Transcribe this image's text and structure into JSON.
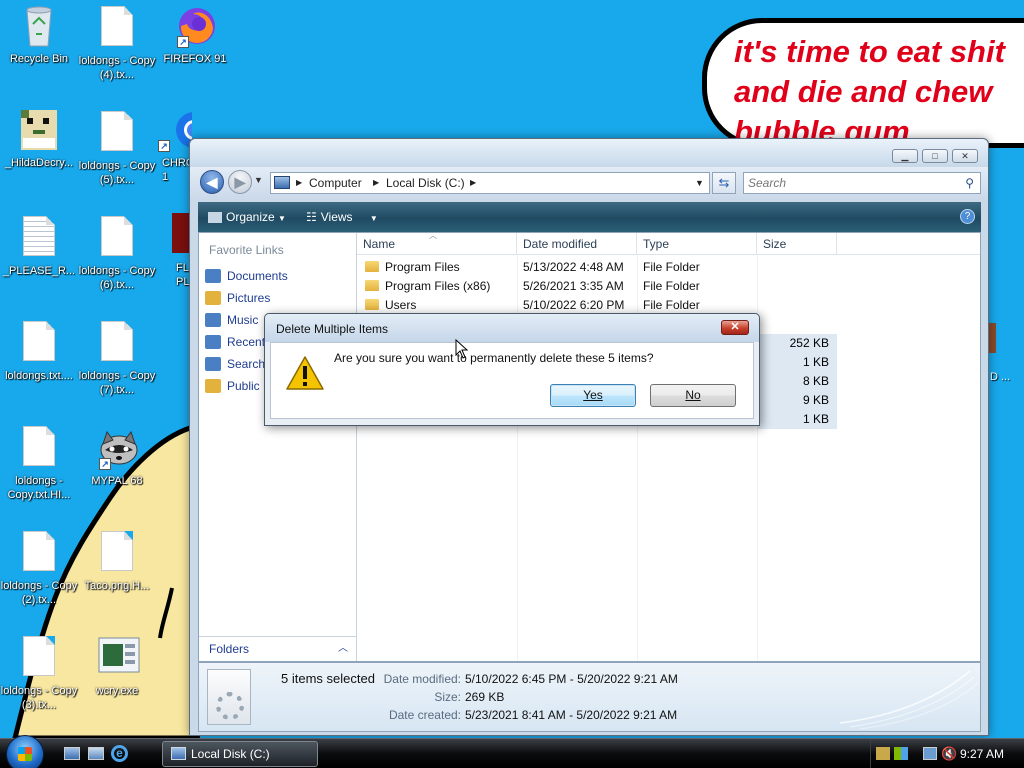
{
  "desktop": {
    "icons": [
      {
        "label": "Recycle Bin",
        "kind": "recycle-bin"
      },
      {
        "label": "loldongs - Copy (4).tx...",
        "kind": "text-file"
      },
      {
        "label": "FIREFOX 91",
        "kind": "firefox"
      },
      {
        "label": "_HildaDecry...",
        "kind": "pixel-cat"
      },
      {
        "label": "loldongs - Copy (5).tx...",
        "kind": "text-file"
      },
      {
        "label": "CHRO 1",
        "kind": "chrome"
      },
      {
        "label": "_PLEASE_R...",
        "kind": "text-file"
      },
      {
        "label": "loldongs - Copy (6).tx...",
        "kind": "text-file"
      },
      {
        "label": "FL PLAY",
        "kind": "flash"
      },
      {
        "label": "loldongs.txt....",
        "kind": "text-file"
      },
      {
        "label": "loldongs - Copy (7).tx...",
        "kind": "text-file"
      },
      {
        "label": "loldongs - Copy.txt.HI...",
        "kind": "text-file"
      },
      {
        "label": "MYPAL 68",
        "kind": "raccoon"
      },
      {
        "label": "loldongs - Copy (2).tx...",
        "kind": "text-file"
      },
      {
        "label": "Taco.png.H...",
        "kind": "text-file"
      },
      {
        "label": "loldongs - Copy (3).tx...",
        "kind": "text-file"
      },
      {
        "label": "wcry.exe",
        "kind": "exe"
      }
    ],
    "speech_bubble": {
      "line1": "it's time to eat shit",
      "line2": "and die and chew",
      "line3": "bubble gum"
    },
    "right_edge_label": "D ..."
  },
  "explorer": {
    "address": {
      "crumbs": [
        "Computer",
        "Local Disk (C:)"
      ]
    },
    "search_placeholder": "Search",
    "toolbar": {
      "organize": "Organize",
      "views": "Views"
    },
    "nav_pane": {
      "heading": "Favorite Links",
      "items": [
        "Documents",
        "Pictures",
        "Music",
        "Recent",
        "Searche",
        "Public"
      ],
      "folders_label": "Folders"
    },
    "columns": [
      "Name",
      "Date modified",
      "Type",
      "Size"
    ],
    "rows": [
      {
        "name": "Program Files",
        "date": "5/13/2022 4:48 AM",
        "type": "File Folder",
        "size": ""
      },
      {
        "name": "Program Files (x86)",
        "date": "5/26/2021 3:35 AM",
        "type": "File Folder",
        "size": ""
      },
      {
        "name": "Users",
        "date": "5/10/2022 6:20 PM",
        "type": "File Folder",
        "size": ""
      }
    ],
    "hidden_sizes": [
      "252 KB",
      "1 KB",
      "8 KB",
      "9 KB",
      "1 KB"
    ],
    "details": {
      "selected": "5 items selected",
      "date_modified_label": "Date modified:",
      "date_modified": "5/10/2022 6:45 PM - 5/20/2022 9:21 AM",
      "size_label": "Size:",
      "size": "269 KB",
      "date_created_label": "Date created:",
      "date_created": "5/23/2021 8:41 AM - 5/20/2022 9:21 AM"
    }
  },
  "dialog": {
    "title": "Delete Multiple Items",
    "message": "Are you sure you want to permanently delete these 5 items?",
    "yes_label": "Yes",
    "no_label": "No"
  },
  "taskbar": {
    "task_label": "Local Disk (C:)",
    "clock": "9:27 AM"
  },
  "colors": {
    "desktop": "#18a9ec",
    "blob": "#f7e7a0",
    "speech_text": "#e0001a"
  }
}
